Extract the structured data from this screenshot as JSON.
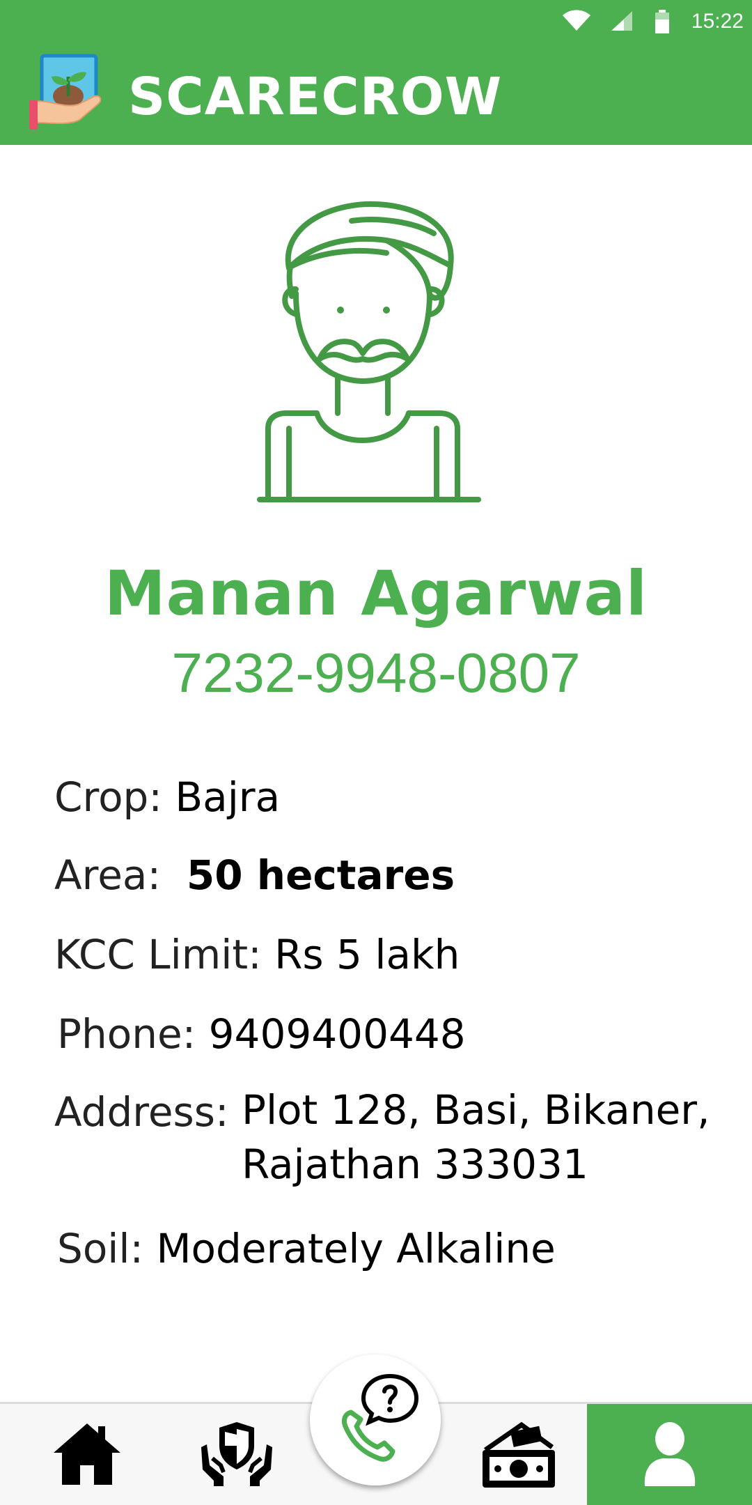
{
  "status_bar": {
    "time": "15:22",
    "icons": [
      "wifi-icon",
      "signal-icon",
      "battery-icon"
    ]
  },
  "app": {
    "title": "SCARECROW",
    "logo_icon": "sprout-in-hand-icon",
    "brand_color": "#4caf50"
  },
  "profile": {
    "avatar_icon": "farmer-turban-icon",
    "name": "Manan Agarwal",
    "number": "7232-9948-0807",
    "details": {
      "crop_label": "Crop:",
      "crop_value": "Bajra",
      "area_label": "Area:",
      "area_value": "50 hectares",
      "kcc_label": "KCC Limit:",
      "kcc_value": "Rs 5 lakh",
      "phone_label": "Phone:",
      "phone_value": "9409400448",
      "address_label": "Address:",
      "address_line1": "Plot 128, Basi, Bikaner,",
      "address_line2": "Rajathan 333031",
      "soil_label": "Soil:",
      "soil_value": "Moderately Alkaline"
    }
  },
  "bottom_nav": {
    "items": [
      {
        "icon": "home-icon",
        "active": false
      },
      {
        "icon": "insurance-shield-hands-icon",
        "active": false
      },
      {
        "icon": "help-call-icon",
        "active": false
      },
      {
        "icon": "money-loan-icon",
        "active": false
      },
      {
        "icon": "profile-icon",
        "active": true
      }
    ]
  }
}
